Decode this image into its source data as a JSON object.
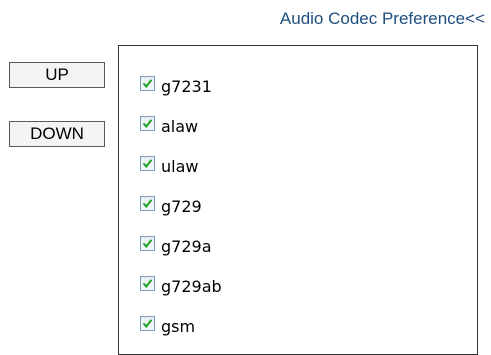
{
  "header": {
    "section_link": "Audio Codec Preference<<"
  },
  "controls": {
    "up_label": "UP",
    "down_label": "DOWN"
  },
  "codecs": [
    {
      "label": "g7231",
      "checked": true
    },
    {
      "label": "alaw",
      "checked": true
    },
    {
      "label": "ulaw",
      "checked": true
    },
    {
      "label": "g729",
      "checked": true
    },
    {
      "label": "g729a",
      "checked": true
    },
    {
      "label": "g729ab",
      "checked": true
    },
    {
      "label": "gsm",
      "checked": true
    }
  ],
  "colors": {
    "link": "#1f4f7f",
    "checkmark": "#21a121",
    "checkbox_border": "#7f9db9"
  },
  "icons": {
    "checkbox": "checkmark-icon"
  }
}
